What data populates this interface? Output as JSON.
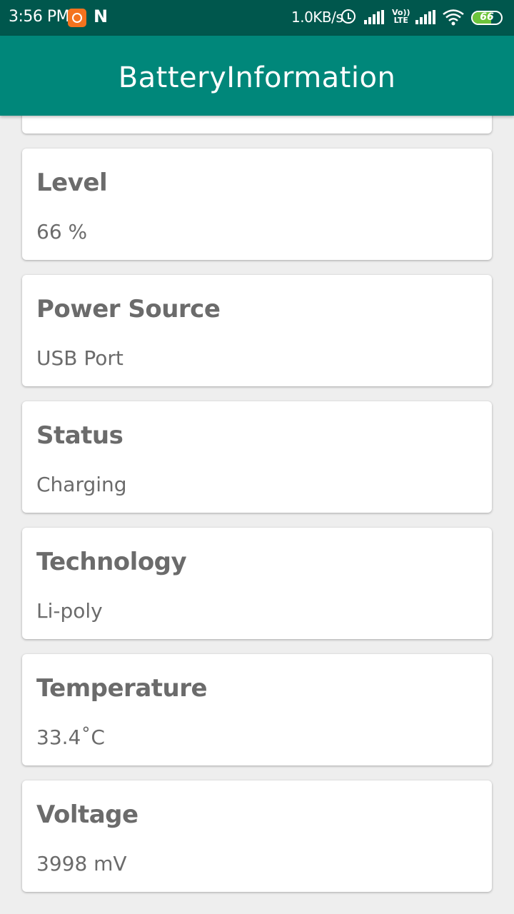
{
  "status_bar": {
    "time": "3:56 PM",
    "net_speed": "1.0KB/s",
    "volte_top": "Vo))",
    "volte_bottom": "LTE",
    "battery_percent": "66",
    "battery_level": 0.66,
    "notification_icons": [
      "app-notification-icon",
      "n-icon"
    ],
    "system_icons": [
      "alarm-icon",
      "signal-icon",
      "volte-icon",
      "signal-icon",
      "wifi-icon",
      "battery-icon"
    ]
  },
  "app_bar": {
    "title": "BatteryInformation"
  },
  "cards": [
    {
      "title": "Level",
      "value": "66 %"
    },
    {
      "title": "Power Source",
      "value": "USB Port"
    },
    {
      "title": "Status",
      "value": "Charging"
    },
    {
      "title": "Technology",
      "value": "Li-poly"
    },
    {
      "title": "Temperature",
      "value": "33.4˚C"
    },
    {
      "title": "Voltage",
      "value": "3998 mV"
    }
  ],
  "colors": {
    "status_bar": "#00574d",
    "app_bar": "#00877a",
    "background": "#eeeeee",
    "card": "#ffffff",
    "text": "#6b6b6b",
    "battery_fill": "#6cc43b",
    "notification_icon": "#f4731e"
  }
}
